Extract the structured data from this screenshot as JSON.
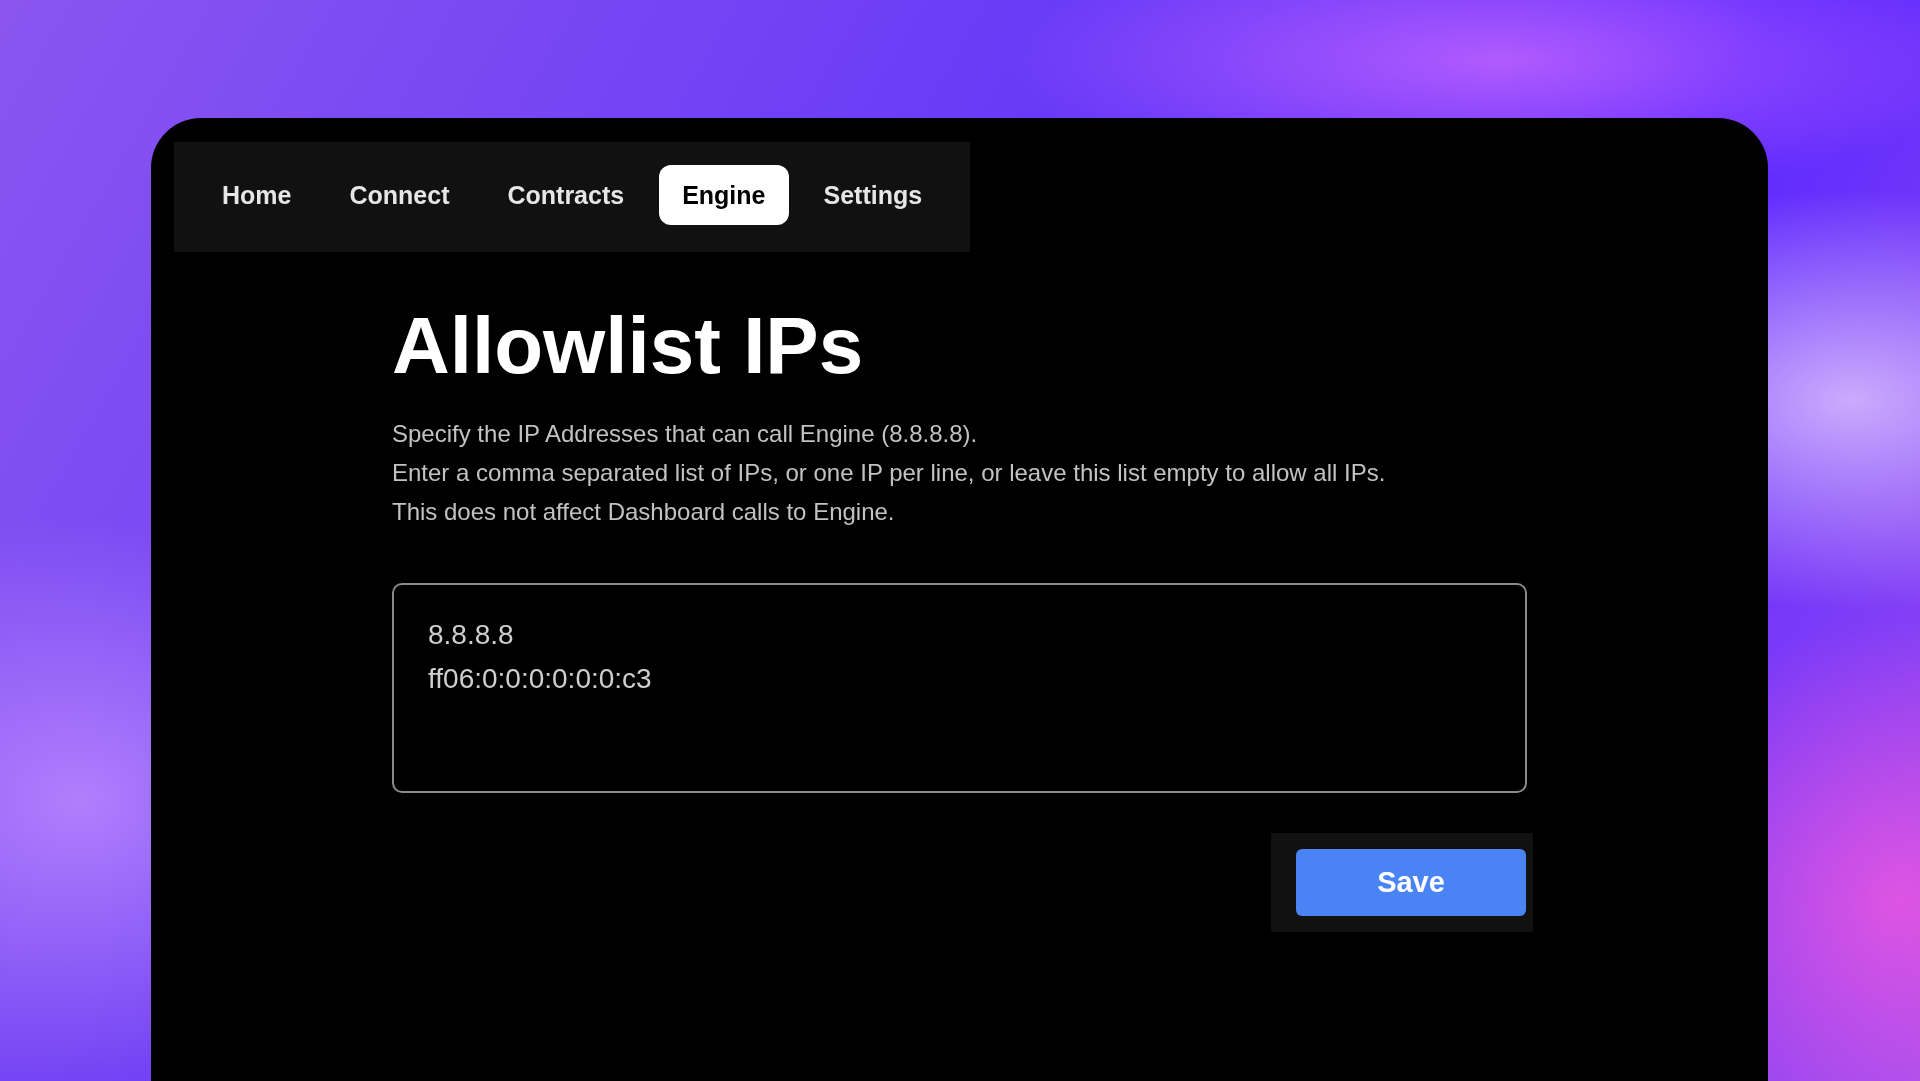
{
  "tabs": [
    {
      "label": "Home",
      "selected": false
    },
    {
      "label": "Connect",
      "selected": false
    },
    {
      "label": "Contracts",
      "selected": false
    },
    {
      "label": "Engine",
      "selected": true
    },
    {
      "label": "Settings",
      "selected": false
    }
  ],
  "title": "Allowlist IPs",
  "description": [
    "Specify the IP Addresses that can call Engine (8.8.8.8).",
    "Enter a comma separated list of IPs, or one IP per line, or leave this list empty to allow all IPs.",
    "This does not affect Dashboard calls to Engine."
  ],
  "ip_list": {
    "value": "8.8.8.8\nff06:0:0:0:0:0:0:c3"
  },
  "save_button": "Save"
}
